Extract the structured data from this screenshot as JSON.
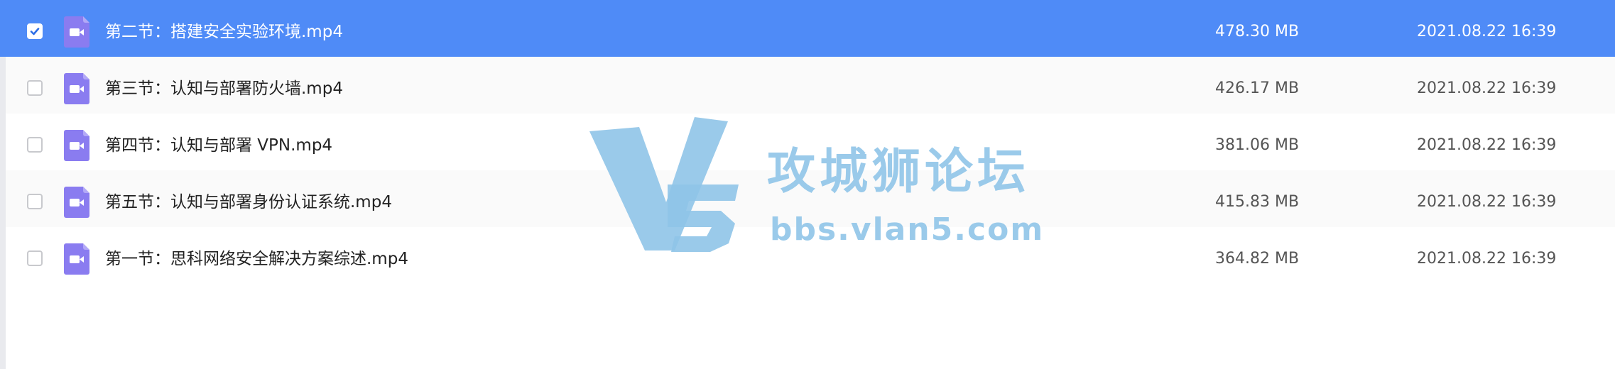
{
  "files": [
    {
      "name": "第二节：搭建安全实验环境.mp4",
      "size": "478.30 MB",
      "date": "2021.08.22 16:39",
      "selected": true
    },
    {
      "name": "第三节：认知与部署防火墙.mp4",
      "size": "426.17 MB",
      "date": "2021.08.22 16:39",
      "selected": false
    },
    {
      "name": "第四节：认知与部署 VPN.mp4",
      "size": "381.06 MB",
      "date": "2021.08.22 16:39",
      "selected": false
    },
    {
      "name": "第五节：认知与部署身份认证系统.mp4",
      "size": "415.83 MB",
      "date": "2021.08.22 16:39",
      "selected": false
    },
    {
      "name": "第一节：思科网络安全解决方案综述.mp4",
      "size": "364.82 MB",
      "date": "2021.08.22 16:39",
      "selected": false
    }
  ],
  "watermark": {
    "logo_text": "V5",
    "title": "攻城狮论坛",
    "url": "bbs.vlan5.com",
    "color": "#8fc4e8"
  },
  "colors": {
    "selected_row": "#4f8bf7",
    "file_icon": "#8a7cf0"
  },
  "icons": {
    "file": "video-file-icon",
    "check": "checkmark-icon"
  }
}
